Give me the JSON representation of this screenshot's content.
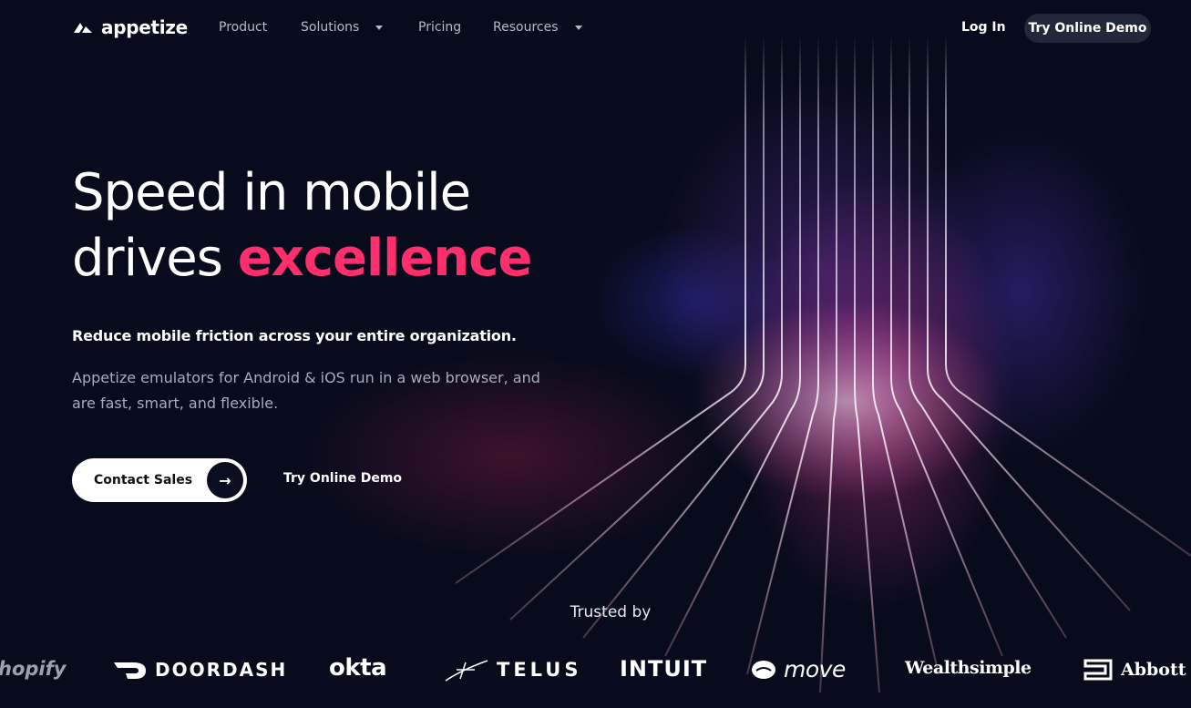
{
  "nav": {
    "brand": "appetize",
    "items": [
      {
        "label": "Product",
        "has_dropdown": false
      },
      {
        "label": "Solutions",
        "has_dropdown": true
      },
      {
        "label": "Pricing",
        "has_dropdown": false
      },
      {
        "label": "Resources",
        "has_dropdown": true
      }
    ],
    "login": "Log In",
    "demo": "Try Online Demo"
  },
  "hero": {
    "title_line1": "Speed in mobile",
    "title_line2_plain": "drives ",
    "title_accent": "excellence",
    "subhead": "Reduce mobile friction across your entire organization.",
    "description": "Appetize emulators for Android & iOS run in a web browser, and are fast, smart, and flexible.",
    "contact_label": "Contact Sales",
    "contact_arrow": "→",
    "demo_label": "Try Online Demo"
  },
  "trusted": {
    "heading": "Trusted by",
    "logos": [
      "hopify",
      "DOORDASH",
      "okta",
      "TELUS",
      "INTUIT",
      "move",
      "Wealthsimple",
      "Abbott"
    ]
  },
  "colors": {
    "background": "#080b1c",
    "accent": "#ff2f6e",
    "nav_button": "#23273a"
  }
}
